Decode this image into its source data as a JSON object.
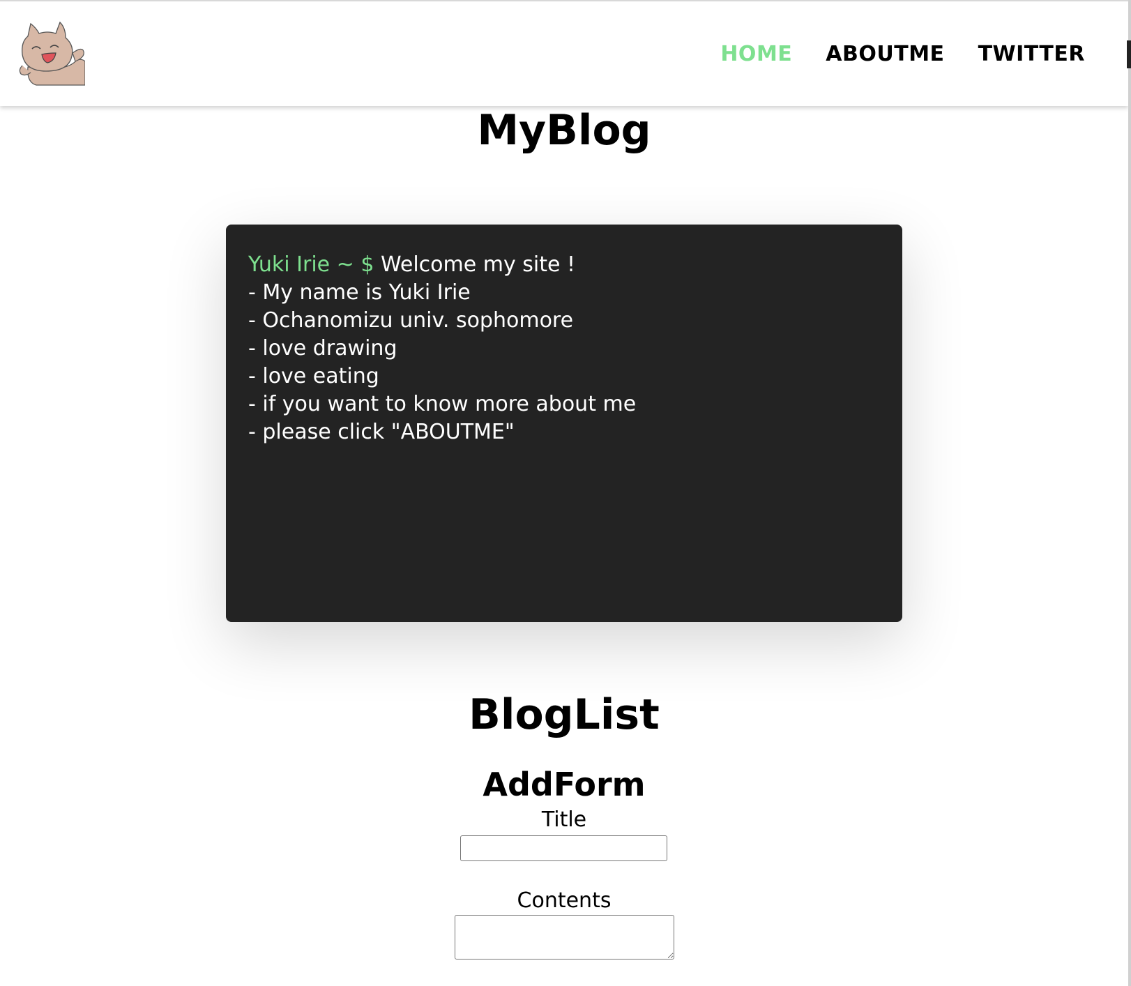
{
  "header": {
    "logo_name": "cat-mascot-logo",
    "nav": [
      {
        "label": "HOME",
        "active": true
      },
      {
        "label": "ABOUTME",
        "active": false
      },
      {
        "label": "TWITTER",
        "active": false
      }
    ]
  },
  "main": {
    "title": "MyBlog",
    "terminal": {
      "prompt": "Yuki Irie ~ $",
      "command": " Welcome my site !",
      "lines": [
        "- My name is Yuki Irie",
        "- Ochanomizu univ. sophomore",
        "- love drawing",
        "- love eating",
        "- if you want to know more about me",
        "- please click \"ABOUTME\""
      ]
    }
  },
  "bloglist": {
    "title": "BlogList",
    "form": {
      "title": "AddForm",
      "title_label": "Title",
      "title_value": "",
      "contents_label": "Contents",
      "contents_value": ""
    }
  },
  "colors": {
    "accent": "#7ee08f",
    "terminal_bg": "#232323"
  }
}
